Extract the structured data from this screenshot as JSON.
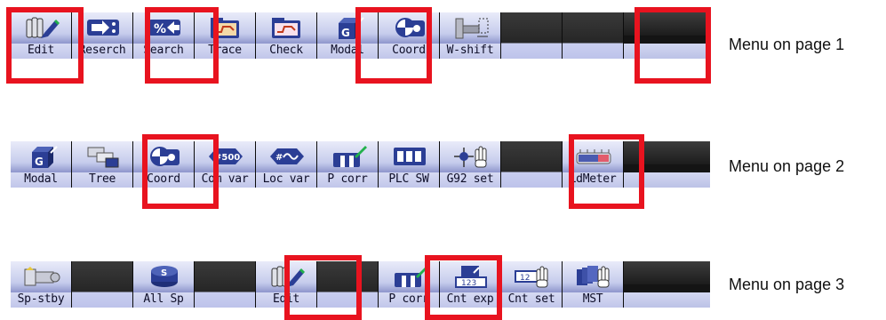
{
  "rows": [
    {
      "caption": "Menu on page 1",
      "keys": [
        {
          "label": "Edit",
          "icon": "edit-hand-pen-icon"
        },
        {
          "label": "Reserch",
          "icon": "arrow-right-colon-icon"
        },
        {
          "label": "Search",
          "icon": "percent-arrow-icon"
        },
        {
          "label": "Trace",
          "icon": "trace-folder-icon"
        },
        {
          "label": "Check",
          "icon": "check-folder-icon"
        },
        {
          "label": "Modal",
          "icon": "modal-g-cube-icon"
        },
        {
          "label": "Coord",
          "icon": "coordinate-target-icon"
        },
        {
          "label": "W-shift",
          "icon": "workpiece-shift-icon"
        },
        {
          "label": "",
          "icon": ""
        },
        {
          "label": "",
          "icon": ""
        }
      ]
    },
    {
      "caption": "Menu on page 2",
      "keys": [
        {
          "label": "Modal",
          "icon": "modal-g-cube-icon"
        },
        {
          "label": "Tree",
          "icon": "tree-tabs-icon"
        },
        {
          "label": "Coord",
          "icon": "coordinate-target-icon"
        },
        {
          "label": "Com var",
          "icon": "common-variable-500-icon"
        },
        {
          "label": "Loc var",
          "icon": "local-variable-wave-icon"
        },
        {
          "label": "P corr",
          "icon": "parameter-correction-icon"
        },
        {
          "label": "PLC SW",
          "icon": "plc-switch-icon"
        },
        {
          "label": "G92 set",
          "icon": "g92-set-hand-icon"
        },
        {
          "label": "",
          "icon": ""
        },
        {
          "label": "LdMeter",
          "icon": "load-meter-icon"
        }
      ]
    },
    {
      "caption": "Menu on page 3",
      "keys": [
        {
          "label": "Sp-stby",
          "icon": "spindle-standby-icon"
        },
        {
          "label": "",
          "icon": ""
        },
        {
          "label": "All Sp",
          "icon": "all-spindle-s-icon"
        },
        {
          "label": "",
          "icon": ""
        },
        {
          "label": "Edit",
          "icon": "edit-hand-pen-icon"
        },
        {
          "label": "",
          "icon": ""
        },
        {
          "label": "P corr",
          "icon": "parameter-correction-icon"
        },
        {
          "label": "Cnt exp",
          "icon": "counter-expand-123-icon"
        },
        {
          "label": "Cnt set",
          "icon": "counter-set-hand-icon"
        },
        {
          "label": "MST",
          "icon": "mst-cards-hand-icon"
        }
      ]
    }
  ],
  "icon_text": {
    "percent": "%",
    "g": "G",
    "five_hundred": "#500",
    "hash": "#",
    "s": "S",
    "one_two_three": "123",
    "one_two": "12"
  },
  "colors": {
    "highlight": "#e8131f",
    "key_face_top": "#e9ebf9",
    "key_label_band": "#d7dbf3",
    "label_text": "#0d0d28",
    "icon_blue": "#2b3e95",
    "icon_green": "#22b14c"
  }
}
